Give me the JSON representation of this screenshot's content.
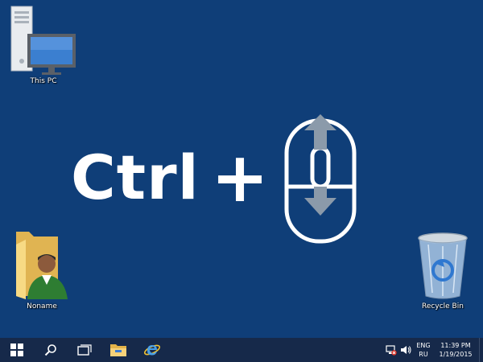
{
  "desktop": {
    "background_color": "#0f3e78",
    "icons": [
      {
        "label": "This PC",
        "icon": "computer-icon"
      },
      {
        "label": "Noname",
        "icon": "user-folder-icon"
      },
      {
        "label": "Recycle Bin",
        "icon": "recycle-bin-icon"
      }
    ]
  },
  "hero": {
    "key_text": "Ctrl",
    "plus_text": "+",
    "mouse_icon": "mouse-scroll-wheel-icon"
  },
  "taskbar": {
    "background_color": "#16294a",
    "buttons": [
      {
        "icon": "windows-start-icon"
      },
      {
        "icon": "search-icon"
      },
      {
        "icon": "task-view-icon"
      },
      {
        "icon": "file-explorer-icon"
      },
      {
        "icon": "internet-explorer-icon"
      }
    ],
    "tray": {
      "network_icon": "network-disconnected-icon",
      "volume_icon": "volume-icon",
      "lang_top": "ENG",
      "lang_bottom": "RU",
      "time": "11:39 PM",
      "date": "1/19/2015"
    }
  }
}
